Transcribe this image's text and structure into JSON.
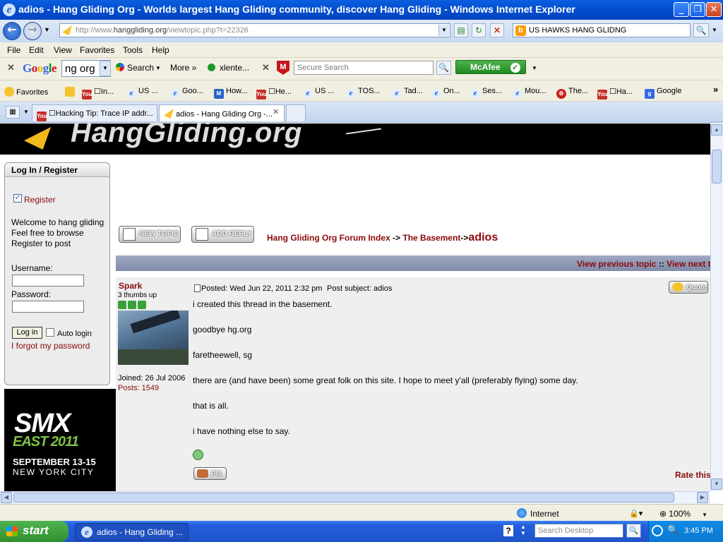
{
  "window": {
    "title": "adios - Hang Gliding Org - Worlds largest Hang Gliding community, discover Hang Gliding - Windows Internet Explorer",
    "minimize": "_",
    "maximize": "❐",
    "close": "✕"
  },
  "nav": {
    "url_prefix": "http://www.",
    "url_domain": "hanggliding.org",
    "url_path": "/viewtopic.php?t=22326",
    "search_value": "US HAWKS HANG GLIDNG",
    "back_glyph": "←",
    "forward_glyph": "→",
    "refresh_glyph": "↻",
    "stop_glyph": "✕",
    "search_glyph": "🔍"
  },
  "menu": [
    "File",
    "Edit",
    "View",
    "Favorites",
    "Tools",
    "Help"
  ],
  "google_toolbar": {
    "close": "✕",
    "logo": "Google",
    "query": "ng org",
    "search_label": "Search",
    "more_label": "More »",
    "xlente_label": "xlente...",
    "close2": "✕",
    "secure_search_placeholder": "Secure Search",
    "mcafee_label": "McAfee",
    "check_glyph": "✓"
  },
  "favorites_bar": {
    "favorites_label": "Favorites",
    "items": [
      {
        "icon": "youtube-icon",
        "badge": "You",
        "label": "☐In..."
      },
      {
        "icon": "ie-icon",
        "badge": "e",
        "label": "US ..."
      },
      {
        "icon": "ie-icon",
        "badge": "e",
        "label": "Goo..."
      },
      {
        "icon": "msn-icon",
        "badge": "M",
        "label": "How..."
      },
      {
        "icon": "youtube-icon",
        "badge": "You",
        "label": "☐He..."
      },
      {
        "icon": "ie-icon",
        "badge": "e",
        "label": "US ..."
      },
      {
        "icon": "ie-icon",
        "badge": "e",
        "label": "TOS..."
      },
      {
        "icon": "ie-icon",
        "badge": "e",
        "label": "Tad..."
      },
      {
        "icon": "ie-icon",
        "badge": "e",
        "label": "On..."
      },
      {
        "icon": "ie-icon",
        "badge": "e",
        "label": "Ses..."
      },
      {
        "icon": "ie-icon",
        "badge": "e",
        "label": "Mou..."
      },
      {
        "icon": "gear-red-icon",
        "badge": "⚙",
        "label": "The..."
      },
      {
        "icon": "youtube-icon",
        "badge": "You",
        "label": "☐Ha..."
      },
      {
        "icon": "google-icon",
        "badge": "g",
        "label": "Google"
      }
    ],
    "chevron": "»"
  },
  "tabs": [
    {
      "label": "☐Hacking Tip: Trace IP addr...",
      "active": false
    },
    {
      "label": "adios - Hang Gliding Org -...",
      "active": true
    }
  ],
  "page": {
    "logo_text": "HangGliding.org",
    "login": {
      "heading": "Log In / Register",
      "register_link": "Register",
      "welcome_lines": [
        "Welcome to hang gliding",
        "Feel free to browse",
        "Register to post"
      ],
      "username_label": "Username:",
      "password_label": "Password:",
      "login_button": "Log in",
      "auto_login": "Auto login",
      "forgot": "I forgot my password"
    },
    "ad": {
      "line1": "SMX",
      "line2": "EAST 2011",
      "line3": "SEPTEMBER 13-15",
      "line4": "NEW YORK CITY"
    },
    "buttons": {
      "new_topic": "NEW TOPIC",
      "add_reply": "ADD REPLY",
      "quote": "Quote",
      "pm": "PM"
    },
    "breadcrumb": {
      "forum_index": "Hang Gliding Org Forum Index",
      "sep1": "->",
      "section": "The Basement",
      "sep2": "->",
      "topic": "adios"
    },
    "topic_nav": {
      "previous": "View previous topic",
      "separator": "::",
      "next": "View next to"
    },
    "post": {
      "author": "Spark",
      "rank": "3 thumbs up",
      "joined": "Joined: 26 Jul 2006",
      "posts": "Posts: 1549",
      "posted": "Posted: Wed Jun 22, 2011 2:32 pm",
      "subject": "Post subject: adios",
      "body": [
        "i created this thread in the basement.",
        "goodbye hg.org",
        "faretheewell, sg",
        "there are (and have been) some great folk on this site. I hope to meet y'all (preferably flying) some day.",
        "that is all.",
        "i have nothing else to say."
      ],
      "rate": "Rate this"
    }
  },
  "status": {
    "zone": "Internet",
    "zoom": "100%"
  },
  "taskbar": {
    "start": "start",
    "window_item": "adios - Hang Gliding ...",
    "search_placeholder": "Search Desktop",
    "time": "3:45 PM"
  },
  "colors": {
    "maroon": "#8b0a0a",
    "title_blue": "#0350d0",
    "taskbar_blue": "#245edb",
    "start_green": "#2f8f2f"
  }
}
